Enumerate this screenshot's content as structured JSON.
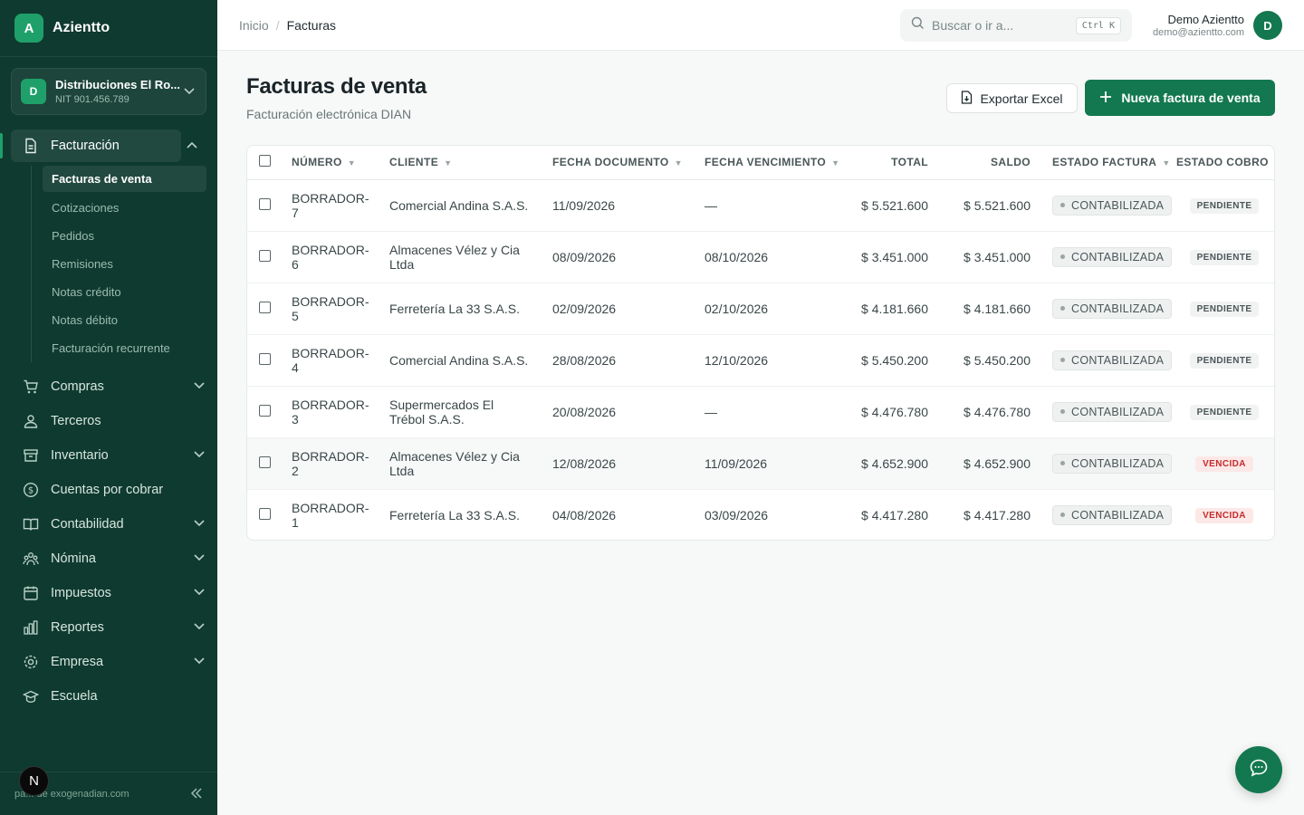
{
  "brand": {
    "logo_letter": "A",
    "name": "Azientto"
  },
  "company": {
    "avatar": "D",
    "name": "Distribuciones El Ro...",
    "nit": "NIT 901.456.789"
  },
  "sidebar": {
    "active": {
      "label": "Facturación",
      "icon": "document-icon"
    },
    "subitems": [
      "Facturas de venta",
      "Cotizaciones",
      "Pedidos",
      "Remisiones",
      "Notas crédito",
      "Notas débito",
      "Facturación recurrente"
    ],
    "items": [
      {
        "label": "Compras",
        "icon": "cart-icon",
        "chevron": true
      },
      {
        "label": "Terceros",
        "icon": "users-icon",
        "chevron": false
      },
      {
        "label": "Inventario",
        "icon": "box-icon",
        "chevron": true
      },
      {
        "label": "Cuentas por cobrar",
        "icon": "dollar-icon",
        "chevron": false
      },
      {
        "label": "Contabilidad",
        "icon": "book-icon",
        "chevron": true
      },
      {
        "label": "Nómina",
        "icon": "team-icon",
        "chevron": true
      },
      {
        "label": "Impuestos",
        "icon": "calendar-icon",
        "chevron": true
      },
      {
        "label": "Reportes",
        "icon": "bar-chart-icon",
        "chevron": true
      },
      {
        "label": "Empresa",
        "icon": "gear-icon",
        "chevron": true
      },
      {
        "label": "Escuela",
        "icon": "graduation-icon",
        "chevron": false
      }
    ],
    "footer_text": "pa... de exogenadian.com",
    "n_badge": "N"
  },
  "topbar": {
    "breadcrumb_home": "Inicio",
    "breadcrumb_sep": "/",
    "breadcrumb_current": "Facturas",
    "search_placeholder": "Buscar o ir a...",
    "shortcut": "Ctrl K",
    "user_name": "Demo Azientto",
    "user_email": "demo@azientto.com",
    "user_avatar": "D"
  },
  "page": {
    "title": "Facturas de venta",
    "subtitle": "Facturación electrónica DIAN",
    "export_label": "Exportar Excel",
    "new_label": "Nueva factura de venta"
  },
  "table": {
    "headers": {
      "numero": "NÚMERO",
      "cliente": "CLIENTE",
      "fecha_doc": "FECHA DOCUMENTO",
      "fecha_venc": "FECHA VENCIMIENTO",
      "total": "TOTAL",
      "saldo": "SALDO",
      "estado": "ESTADO FACTURA",
      "cobro": "ESTADO COBRO"
    },
    "rows": [
      {
        "numero_a": "BORRADOR-",
        "numero_b": "7",
        "cliente_a": "Comercial Andina S.A.S.",
        "cliente_b": "",
        "fecha_doc": "11/09/2026",
        "fecha_venc": "—",
        "total": "$ 5.521.600",
        "saldo": "$ 5.521.600",
        "estado": "CONTABILIZADA",
        "cobro": "PENDIENTE"
      },
      {
        "numero_a": "BORRADOR-",
        "numero_b": "6",
        "cliente_a": "Almacenes Vélez y Cia",
        "cliente_b": "Ltda",
        "fecha_doc": "08/09/2026",
        "fecha_venc": "08/10/2026",
        "total": "$ 3.451.000",
        "saldo": "$ 3.451.000",
        "estado": "CONTABILIZADA",
        "cobro": "PENDIENTE"
      },
      {
        "numero_a": "BORRADOR-",
        "numero_b": "5",
        "cliente_a": "Ferretería La 33 S.A.S.",
        "cliente_b": "",
        "fecha_doc": "02/09/2026",
        "fecha_venc": "02/10/2026",
        "total": "$ 4.181.660",
        "saldo": "$ 4.181.660",
        "estado": "CONTABILIZADA",
        "cobro": "PENDIENTE"
      },
      {
        "numero_a": "BORRADOR-",
        "numero_b": "4",
        "cliente_a": "Comercial Andina S.A.S.",
        "cliente_b": "",
        "fecha_doc": "28/08/2026",
        "fecha_venc": "12/10/2026",
        "total": "$ 5.450.200",
        "saldo": "$ 5.450.200",
        "estado": "CONTABILIZADA",
        "cobro": "PENDIENTE"
      },
      {
        "numero_a": "BORRADOR-",
        "numero_b": "3",
        "cliente_a": "Supermercados El",
        "cliente_b": "Trébol S.A.S.",
        "fecha_doc": "20/08/2026",
        "fecha_venc": "—",
        "total": "$ 4.476.780",
        "saldo": "$ 4.476.780",
        "estado": "CONTABILIZADA",
        "cobro": "PENDIENTE"
      },
      {
        "numero_a": "BORRADOR-",
        "numero_b": "2",
        "cliente_a": "Almacenes Vélez y Cia",
        "cliente_b": "Ltda",
        "fecha_doc": "12/08/2026",
        "fecha_venc": "11/09/2026",
        "total": "$ 4.652.900",
        "saldo": "$ 4.652.900",
        "estado": "CONTABILIZADA",
        "cobro": "VENCIDA"
      },
      {
        "numero_a": "BORRADOR-",
        "numero_b": "1",
        "cliente_a": "Ferretería La 33 S.A.S.",
        "cliente_b": "",
        "fecha_doc": "04/08/2026",
        "fecha_venc": "03/09/2026",
        "total": "$ 4.417.280",
        "saldo": "$ 4.417.280",
        "estado": "CONTABILIZADA",
        "cobro": "VENCIDA"
      }
    ]
  },
  "colors": {
    "sidebar_bg": "#0f3a2f",
    "accent": "#13784f",
    "danger": "#c42b2b"
  }
}
